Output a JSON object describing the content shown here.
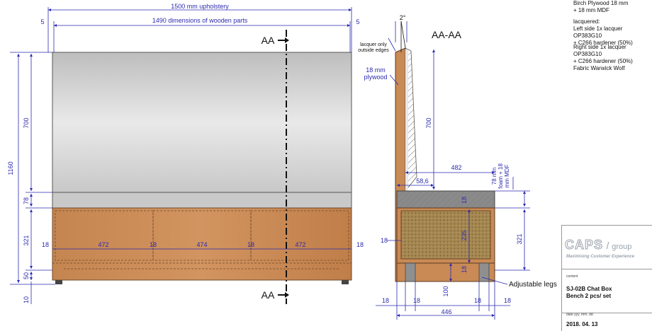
{
  "dimensions": {
    "upholstery_width": "1500 mm upholstery",
    "wooden_parts_width": "1490 dimensions of wooden parts",
    "left_offset": "5",
    "right_offset": "5",
    "total_height": "1160",
    "back_height": "700",
    "seat_cushion": "78",
    "base_height": "321",
    "leg_height": "50",
    "floor_clearance": "10",
    "panel_widths": [
      "472",
      "474",
      "472"
    ],
    "panel_gaps": [
      "18",
      "18",
      "18",
      "18",
      "18"
    ],
    "section_back_height": "700",
    "section_seat_depth": "482",
    "section_top_depth": "58,6",
    "section_seat_layers": "78 mm\nfoam + 18 mm MDF",
    "section_base_height": "321",
    "section_inner_height": "235",
    "section_top_board": "18",
    "section_bottom_board": "18",
    "section_side_board": "18",
    "section_leg_height": "100",
    "section_bottom_left": [
      "18",
      "18"
    ],
    "section_bottom_right": [
      "18",
      "18"
    ],
    "section_total_depth": "446",
    "angle": "2°"
  },
  "labels": {
    "section_marker": "AA",
    "section_title": "AA-AA",
    "lacquer_note": "lacquer only\noutside edges",
    "plywood_note": "18 mm\nplywood",
    "legs_note": "Adjustable legs"
  },
  "notes": {
    "material": "Birch Plywood 18 mm\n+ 18 mm MDF",
    "lacquer_title": "lacquered:",
    "lacquer_left": "Left side 1x lacquer OP383G10\n+ C266 hardener (50%)",
    "lacquer_right": "Right side 1x lacquer OP383G10\n+ C266 hardener (50%)",
    "fabric": "Fabric Warwick Wolf"
  },
  "title_block": {
    "logo_main": "CAPS",
    "logo_group": "group",
    "tagline": "Maximising Customer Experience",
    "content_label": "content",
    "product": "SJ-02B Chat Box",
    "quantity": "Bench 2 pcs/ set",
    "date_label": "date   yyy. mm. dd",
    "date": "2018. 04. 13"
  },
  "colors": {
    "dimension": "#2a2ab0",
    "wood": "#c98a55",
    "upholstery": "#cdcdcd",
    "seat": "#8a8a8a"
  }
}
